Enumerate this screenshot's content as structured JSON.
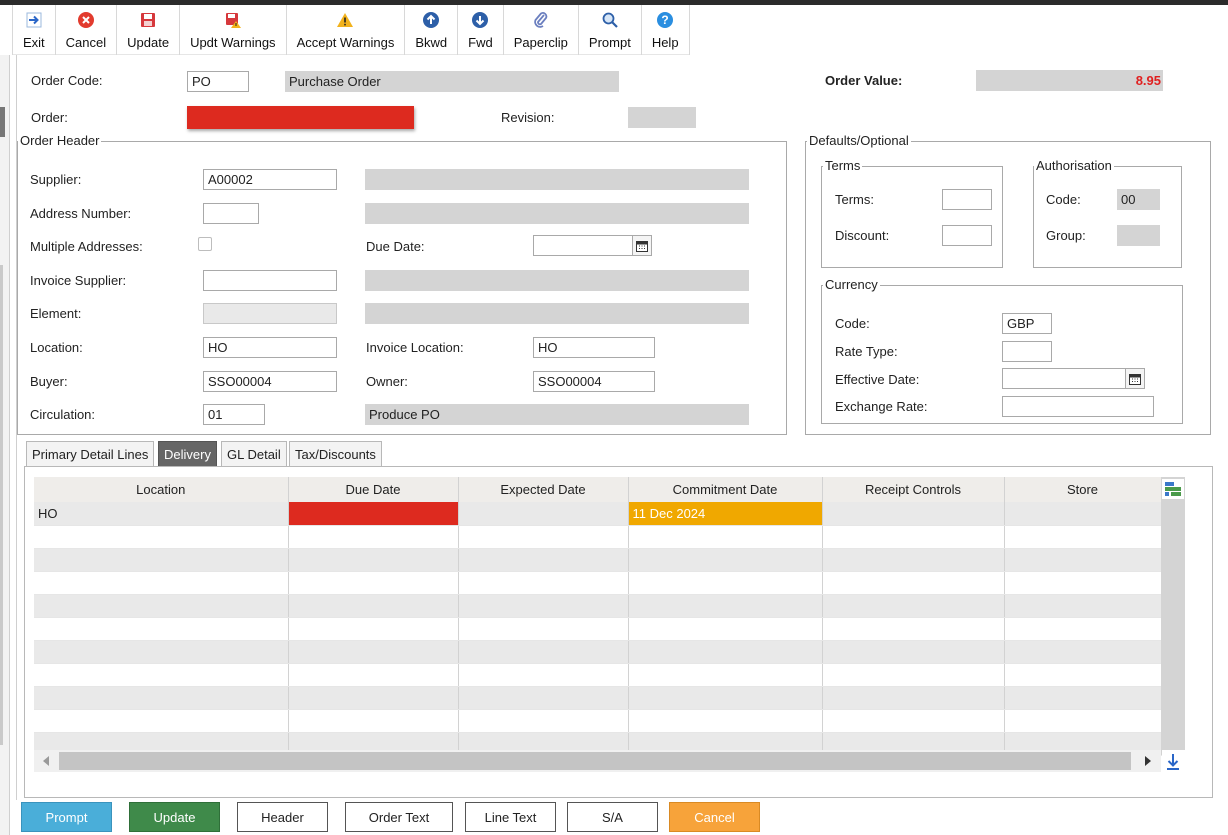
{
  "toolbar": [
    {
      "label": "Exit",
      "icon": "exit-arrow-icon"
    },
    {
      "label": "Cancel",
      "icon": "cancel-icon"
    },
    {
      "label": "Update",
      "icon": "save-icon"
    },
    {
      "label": "Updt Warnings",
      "icon": "save-warning-icon"
    },
    {
      "label": "Accept Warnings",
      "icon": "warning-icon"
    },
    {
      "label": "Bkwd",
      "icon": "arrow-up-icon"
    },
    {
      "label": "Fwd",
      "icon": "arrow-down-icon"
    },
    {
      "label": "Paperclip",
      "icon": "paperclip-icon"
    },
    {
      "label": "Prompt",
      "icon": "magnifier-icon"
    },
    {
      "label": "Help",
      "icon": "help-icon"
    }
  ],
  "order": {
    "code_label": "Order Code:",
    "code_value": "PO",
    "code_desc": "Purchase Order",
    "order_label": "Order:",
    "revision_label": "Revision:",
    "value_label": "Order Value:",
    "value": "8.95",
    "value_color": "#e02020",
    "order_highlight_color": "#dd2a1f"
  },
  "header": {
    "legend": "Order Header",
    "supplier_label": "Supplier:",
    "supplier_value": "A00002",
    "address_label": "Address Number:",
    "multiple_label": "Multiple Addresses:",
    "due_date_label": "Due Date:",
    "invoice_supplier_label": "Invoice Supplier:",
    "element_label": "Element:",
    "location_label": "Location:",
    "location_value": "HO",
    "invoice_location_label": "Invoice Location:",
    "invoice_location_value": "HO",
    "buyer_label": "Buyer:",
    "buyer_value": "SSO00004",
    "owner_label": "Owner:",
    "owner_value": "SSO00004",
    "circulation_label": "Circulation:",
    "circulation_value": "01",
    "circulation_desc": "Produce PO"
  },
  "defaults": {
    "legend": "Defaults/Optional",
    "terms_legend": "Terms",
    "terms_label": "Terms:",
    "discount_label": "Discount:",
    "auth_legend": "Authorisation",
    "auth_code_label": "Code:",
    "auth_code_value": "00",
    "auth_group_label": "Group:",
    "currency_legend": "Currency",
    "cur_code_label": "Code:",
    "cur_code_value": "GBP",
    "rate_type_label": "Rate Type:",
    "effective_date_label": "Effective Date:",
    "exchange_rate_label": "Exchange Rate:"
  },
  "tabs": [
    {
      "label": "Primary Detail Lines",
      "active": false
    },
    {
      "label": "Delivery",
      "active": true
    },
    {
      "label": "GL Detail",
      "active": false
    },
    {
      "label": "Tax/Discounts",
      "active": false
    }
  ],
  "grid": {
    "columns": [
      "Location",
      "Due Date",
      "Expected Date",
      "Commitment Date",
      "Receipt Controls",
      "Store"
    ],
    "rows": [
      {
        "location": "HO",
        "due_date": "",
        "expected_date": "",
        "commitment_date": "11 Dec 2024",
        "receipt_controls": "",
        "store": ""
      }
    ],
    "empty_rows": 10,
    "due_highlight_color": "#dd2a1f",
    "commitment_highlight_color": "#f0a800"
  },
  "buttons": [
    {
      "label": "Prompt",
      "style": "prompt"
    },
    {
      "label": "Update",
      "style": "update"
    },
    {
      "label": "Header",
      "style": "plain"
    },
    {
      "label": "Order Text",
      "style": "plain"
    },
    {
      "label": "Line Text",
      "style": "plain"
    },
    {
      "label": "S/A",
      "style": "plain"
    },
    {
      "label": "Cancel",
      "style": "cancel"
    }
  ],
  "colors": {
    "prompt_button": "#4aaed9",
    "update_button": "#3f8a4a",
    "cancel_button": "#f7a33a",
    "active_tab": "#666666"
  }
}
